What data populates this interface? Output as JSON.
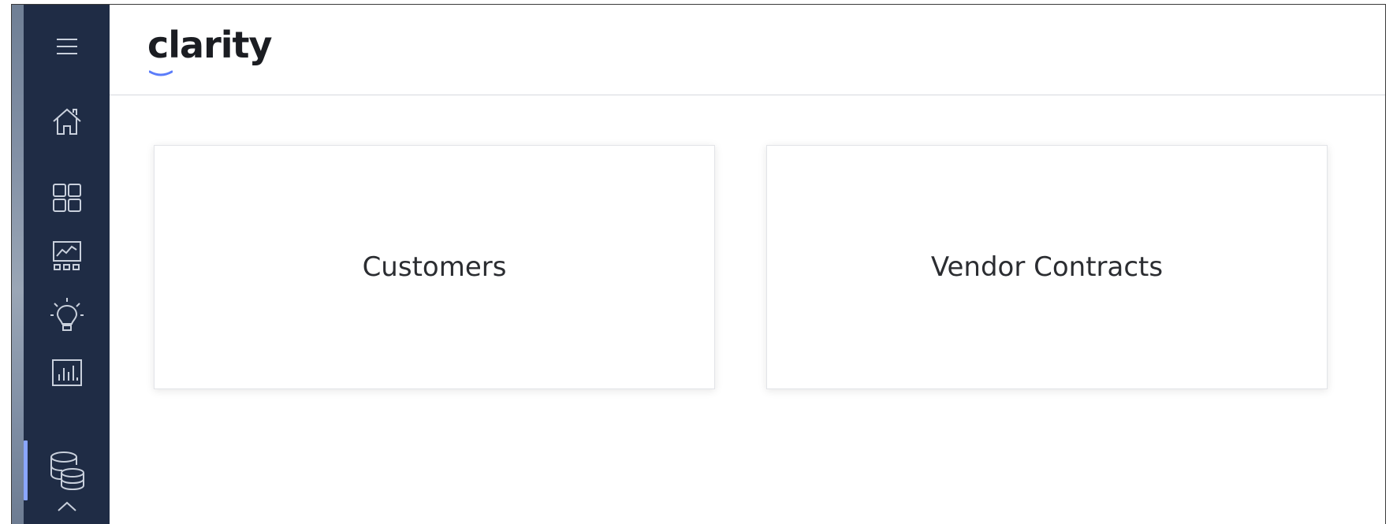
{
  "app": {
    "brand": "clarity",
    "accent_color": "#8aa6ff",
    "sidebar_color": "#1f2c45"
  },
  "sidebar": {
    "items": [
      {
        "name": "menu",
        "icon": "hamburger-menu-icon"
      },
      {
        "name": "home",
        "icon": "home-icon"
      },
      {
        "name": "dashboards",
        "icon": "grid-icon"
      },
      {
        "name": "presentations",
        "icon": "presentation-chart-icon"
      },
      {
        "name": "insights",
        "icon": "lightbulb-icon"
      },
      {
        "name": "reports",
        "icon": "bar-chart-icon"
      },
      {
        "name": "data",
        "icon": "database-icon",
        "active": true
      },
      {
        "name": "more",
        "icon": "chevron-up-icon"
      }
    ]
  },
  "cards": [
    {
      "label": "Customers"
    },
    {
      "label": "Vendor Contracts"
    }
  ]
}
